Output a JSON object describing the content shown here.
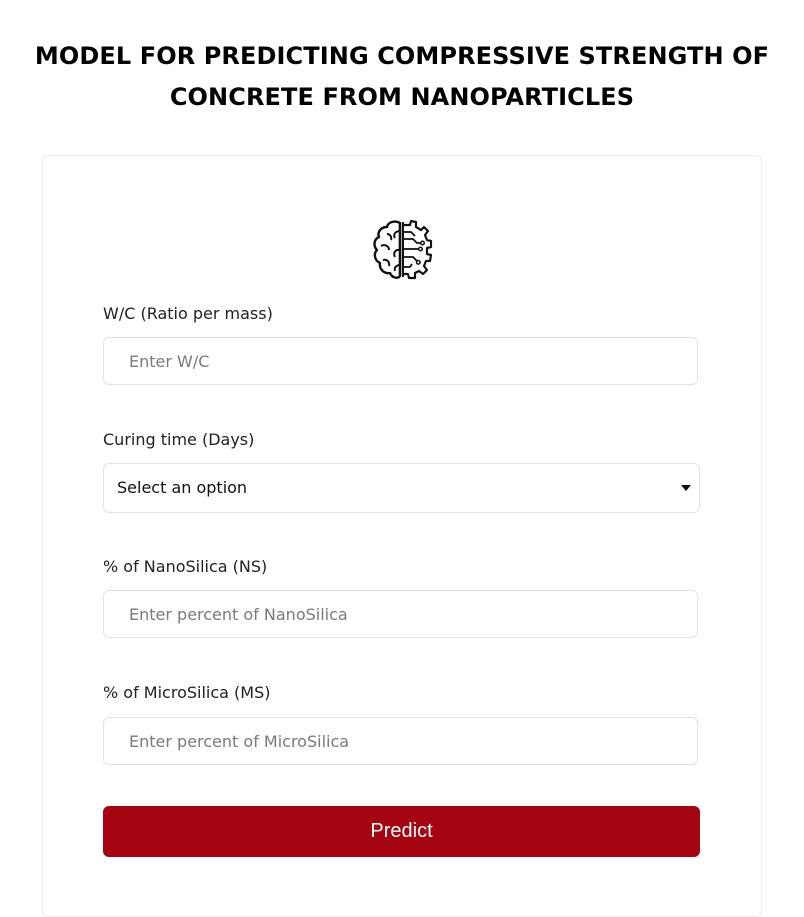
{
  "page": {
    "title": "MODEL FOR PREDICTING COMPRESSIVE STRENGTH OF CONCRETE FROM NANOPARTICLES"
  },
  "logo": {
    "icon": "brain-gear-icon"
  },
  "form": {
    "wc": {
      "label": "W/C (Ratio per mass)",
      "placeholder": "Enter W/C",
      "value": ""
    },
    "curing": {
      "label": "Curing time (Days)",
      "selected": "Select an option"
    },
    "nanosilica": {
      "label": "% of NanoSilica (NS)",
      "placeholder": "Enter percent of NanoSilica",
      "value": ""
    },
    "microsilica": {
      "label": "% of MicroSilica (MS)",
      "placeholder": "Enter percent of MicroSilica",
      "value": ""
    },
    "submit_label": "Predict"
  },
  "colors": {
    "accent": "#a50511",
    "border": "#e2e2e2"
  }
}
